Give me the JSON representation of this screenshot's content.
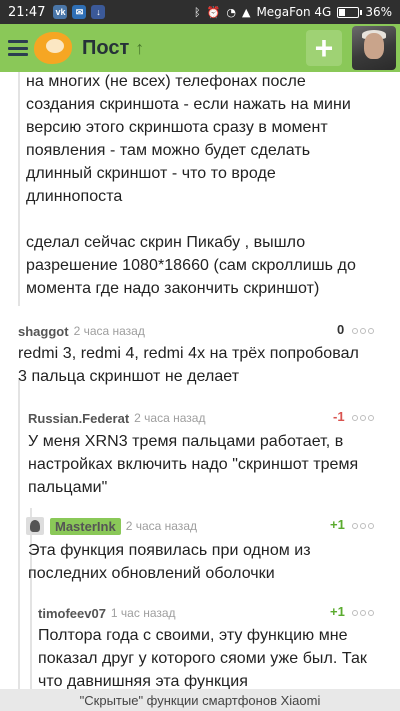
{
  "status_bar": {
    "time": "21:47",
    "carrier": "MegaFon 4G",
    "battery": "36%",
    "battery_level": 0.36,
    "icons": [
      "vk-icon",
      "mail-icon",
      "download-icon",
      "bluetooth-icon",
      "alarm-icon",
      "wifi-icon",
      "signal-icon"
    ]
  },
  "app_bar": {
    "title": "Пост",
    "menu_icon": "hamburger-menu-icon",
    "logo_icon": "pikabu-logo-icon",
    "scroll_up_icon": "arrow-up-icon",
    "add_label": "+",
    "accent_color": "#8ac858"
  },
  "comments": [
    {
      "continued": true,
      "lines": [
        "на многих (не всех) телефонах после",
        "создания скриншота - если нажать на мини",
        "версию этого скриншота сразу в момент",
        "появления - там можно будет сделать",
        "длинный скриншот - что то вроде",
        "длиннопоста",
        "",
        "сделал сейчас скрин Пикабу , вышло",
        "разрешение 1080*18660 (сам скроллишь до",
        "момента где надо закончить скриншот)"
      ]
    },
    {
      "author": "shaggot",
      "time": "2 часа назад",
      "score": "0",
      "score_color": "#333333",
      "lines": [
        "redmi 3, redmi 4, redmi 4x на трёх попробовал",
        "3 пальца скриншот не делает"
      ]
    },
    {
      "author": "Russian.Federat",
      "time": "2 часа назад",
      "score": "-1",
      "score_color": "#d9534f",
      "lines": [
        "У меня XRN3 тремя пальцами работает, в",
        "настройках включить надо \"скриншот тремя",
        "пальцами\""
      ]
    },
    {
      "author": "MasterInk",
      "time": "2 часа назад",
      "score": "+1",
      "score_color": "#5aab2e",
      "is_post_author": true,
      "lines": [
        "Эта функция появилась при одном из",
        "последних обновлений оболочки"
      ]
    },
    {
      "author": "timofeev07",
      "time": "1 час назад",
      "score": "+1",
      "score_color": "#5aab2e",
      "lines": [
        "Полтора года с своими, эту функцию мне",
        "показал друг у которого сяоми уже был. Так",
        "что давнишняя эта функция"
      ]
    }
  ],
  "bottom_bar": {
    "post_title": "\"Скрытые\" функции смартфонов Xiaomi"
  }
}
